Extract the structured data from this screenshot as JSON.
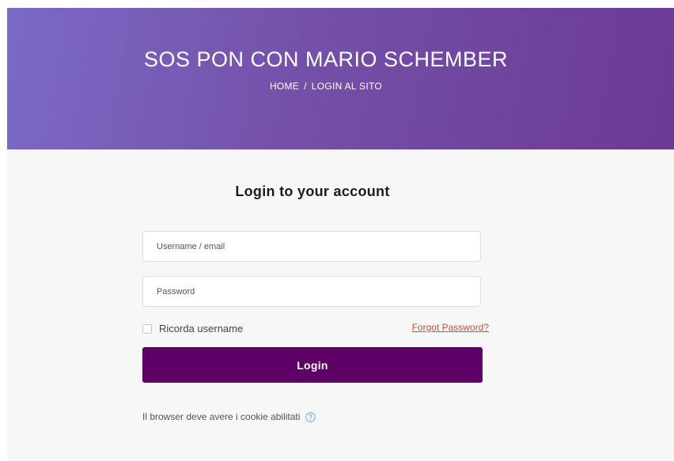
{
  "hero": {
    "title": "SOS PON CON MARIO SCHEMBER",
    "breadcrumb": [
      "HOME",
      "LOGIN AL SITO"
    ],
    "breadcrumb_separator": "/"
  },
  "login": {
    "heading": "Login to your account",
    "username_placeholder": "Username / email",
    "password_placeholder": "Password",
    "remember_label": "Ricorda username",
    "forgot_label": "Forgot Password?",
    "button_label": "Login",
    "cookie_note": "Il browser deve avere i cookie abilitati"
  },
  "colors": {
    "hero_gradient_start": "#7b6ac7",
    "hero_gradient_end": "#6b3a94",
    "login_button": "#5e0066",
    "forgot_link": "#c0532f",
    "help_icon": "#5aa9d6"
  },
  "icons": {
    "cookie_help": "question-circle-icon"
  }
}
